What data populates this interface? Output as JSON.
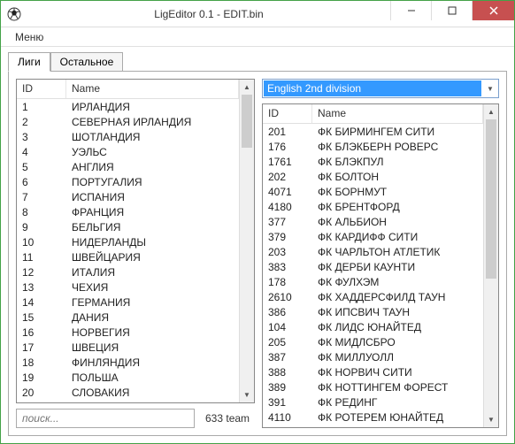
{
  "window": {
    "title": "LigEditor 0.1 - EDIT.bin"
  },
  "menu": {
    "main": "Меню"
  },
  "tabs": {
    "t1": "Лиги",
    "t2": "Остальное"
  },
  "left": {
    "headers": {
      "id": "ID",
      "name": "Name"
    },
    "rows": [
      {
        "id": "1",
        "name": "ИРЛАНДИЯ"
      },
      {
        "id": "2",
        "name": "СЕВЕРНАЯ ИРЛАНДИЯ"
      },
      {
        "id": "3",
        "name": "ШОТЛАНДИЯ"
      },
      {
        "id": "4",
        "name": "УЭЛЬС"
      },
      {
        "id": "5",
        "name": "АНГЛИЯ"
      },
      {
        "id": "6",
        "name": "ПОРТУГАЛИЯ"
      },
      {
        "id": "7",
        "name": "ИСПАНИЯ"
      },
      {
        "id": "8",
        "name": "ФРАНЦИЯ"
      },
      {
        "id": "9",
        "name": "БЕЛЬГИЯ"
      },
      {
        "id": "10",
        "name": "НИДЕРЛАНДЫ"
      },
      {
        "id": "11",
        "name": "ШВЕЙЦАРИЯ"
      },
      {
        "id": "12",
        "name": "ИТАЛИЯ"
      },
      {
        "id": "13",
        "name": "ЧЕХИЯ"
      },
      {
        "id": "14",
        "name": "ГЕРМАНИЯ"
      },
      {
        "id": "15",
        "name": "ДАНИЯ"
      },
      {
        "id": "16",
        "name": "НОРВЕГИЯ"
      },
      {
        "id": "17",
        "name": "ШВЕЦИЯ"
      },
      {
        "id": "18",
        "name": "ФИНЛЯНДИЯ"
      },
      {
        "id": "19",
        "name": "ПОЛЬША"
      },
      {
        "id": "20",
        "name": "СЛОВАКИЯ"
      }
    ],
    "search_placeholder": "поиск...",
    "team_count": "633 team"
  },
  "right": {
    "combo_selected": "English 2nd division",
    "headers": {
      "id": "ID",
      "name": "Name"
    },
    "rows": [
      {
        "id": "201",
        "name": "ФК БИРМИНГЕМ СИТИ"
      },
      {
        "id": "176",
        "name": "ФК БЛЭКБЕРН РОВЕРС"
      },
      {
        "id": "1761",
        "name": "ФК БЛЭКПУЛ"
      },
      {
        "id": "202",
        "name": "ФК БОЛТОН"
      },
      {
        "id": "4071",
        "name": "ФК БОРНМУТ"
      },
      {
        "id": "4180",
        "name": "ФК БРЕНТФОРД"
      },
      {
        "id": "377",
        "name": "ФК АЛЬБИОН"
      },
      {
        "id": "379",
        "name": "ФК КАРДИФФ СИТИ"
      },
      {
        "id": "203",
        "name": "ФК ЧАРЛЬТОН АТЛЕТИК"
      },
      {
        "id": "383",
        "name": "ФК ДЕРБИ КАУНТИ"
      },
      {
        "id": "178",
        "name": "ФК ФУЛХЭМ"
      },
      {
        "id": "2610",
        "name": "ФК ХАДДЕРСФИЛД ТАУН"
      },
      {
        "id": "386",
        "name": "ФК ИПСВИЧ ТАУН"
      },
      {
        "id": "104",
        "name": "ФК ЛИДС ЮНАЙТЕД"
      },
      {
        "id": "205",
        "name": "ФК МИДЛСБРО"
      },
      {
        "id": "387",
        "name": "ФК МИЛЛУОЛЛ"
      },
      {
        "id": "388",
        "name": "ФК НОРВИЧ СИТИ"
      },
      {
        "id": "389",
        "name": "ФК НОТТИНГЕМ ФОРЕСТ"
      },
      {
        "id": "391",
        "name": "ФК РЕДИНГ"
      },
      {
        "id": "4110",
        "name": "ФК РОТЕРЕМ ЮНАЙТЕД"
      }
    ]
  }
}
